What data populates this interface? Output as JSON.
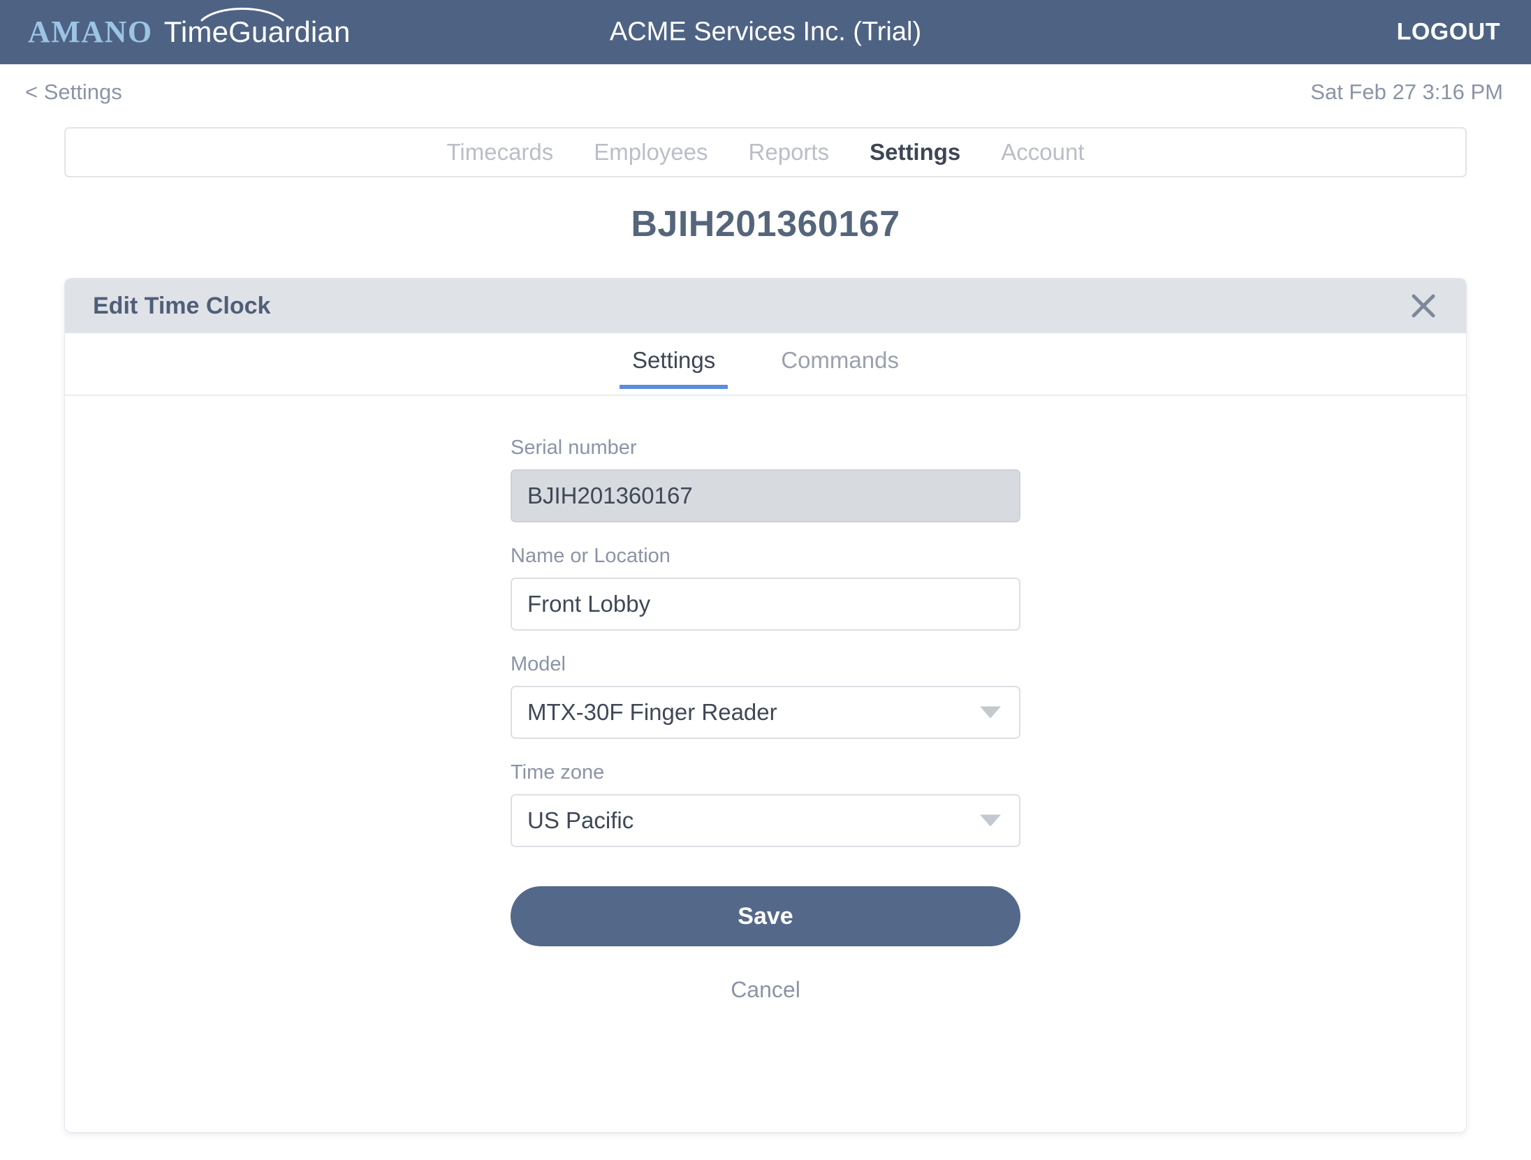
{
  "topbar": {
    "brand_primary": "AMANO",
    "brand_secondary": "TimeGuardian",
    "company_title": "ACME Services Inc. (Trial)",
    "logout_label": "LOGOUT",
    "bar_color": "#4e6384",
    "brand_primary_color": "#9dc4e4"
  },
  "subheader": {
    "back_label": "< Settings",
    "clock": "Sat Feb 27 3:16 PM"
  },
  "nav": {
    "items": [
      {
        "label": "Timecards",
        "active": false
      },
      {
        "label": "Employees",
        "active": false
      },
      {
        "label": "Reports",
        "active": false
      },
      {
        "label": "Settings",
        "active": true
      },
      {
        "label": "Account",
        "active": false
      }
    ]
  },
  "page": {
    "title": "BJIH201360167"
  },
  "card": {
    "header_title": "Edit Time Clock",
    "close_icon": "close-icon",
    "tabs": [
      {
        "label": "Settings",
        "active": true
      },
      {
        "label": "Commands",
        "active": false
      }
    ],
    "accent_color": "#5b8dd9",
    "form": {
      "serial": {
        "label": "Serial number",
        "value": "BJIH201360167",
        "disabled": true
      },
      "name": {
        "label": "Name or Location",
        "value": "Front Lobby",
        "placeholder": "Name or Location"
      },
      "model": {
        "label": "Model",
        "value": "MTX-30F Finger Reader",
        "caret_icon": "chevron-down-icon"
      },
      "timezone": {
        "label": "Time zone",
        "value": "US Pacific",
        "caret_icon": "chevron-down-icon"
      },
      "save_label": "Save",
      "cancel_label": "Cancel",
      "save_color": "#54688a"
    }
  }
}
